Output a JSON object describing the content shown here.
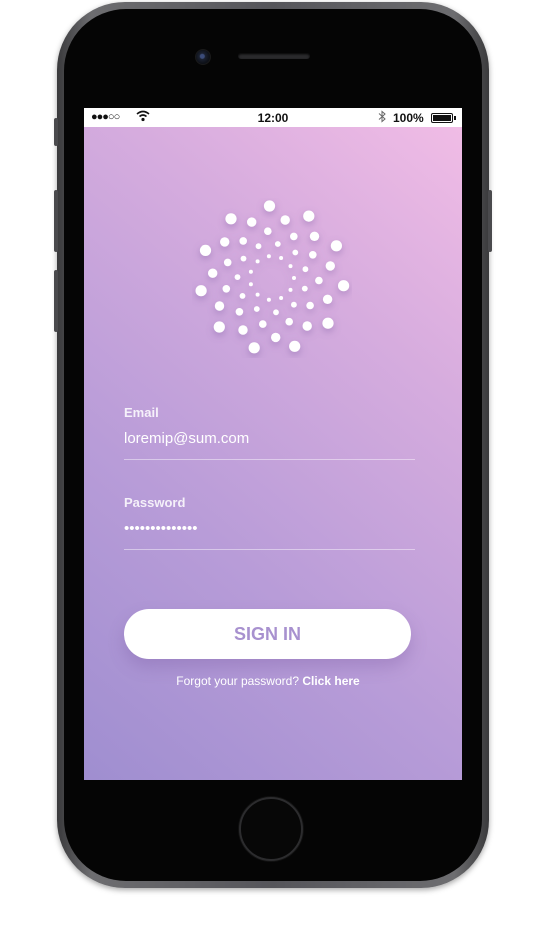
{
  "status_bar": {
    "signal": "●●●○○",
    "time": "12:00",
    "battery": "100%"
  },
  "logo": {
    "icon": "dotted-spiral-logo-icon"
  },
  "form": {
    "email_label": "Email",
    "email_value": "loremip@sum.com",
    "password_label": "Password",
    "password_value": "••••••••••••••"
  },
  "actions": {
    "signin_label": "SIGN IN",
    "forgot_text": "Forgot your password?",
    "forgot_link": "Click here"
  },
  "colors": {
    "gradient_start": "#9f8ed0",
    "gradient_end": "#f2bde6",
    "button_text": "#a891cf"
  }
}
